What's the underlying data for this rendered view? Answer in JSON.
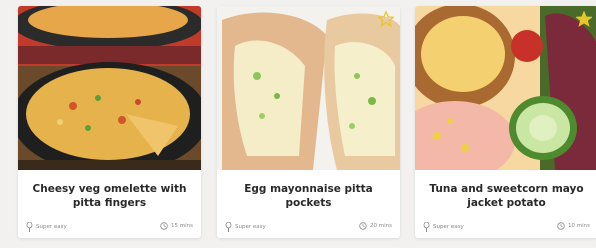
{
  "cards": [
    {
      "title": "Cheesy veg omelette with pitta fingers",
      "difficulty": "Super easy",
      "time": "15 mins",
      "difficulty_icon": "whisk-icon",
      "time_icon": "clock-icon"
    },
    {
      "title": "Egg mayonnaise pitta pockets",
      "difficulty": "Super easy",
      "time": "20 mins",
      "difficulty_icon": "whisk-icon",
      "time_icon": "clock-icon",
      "favourite_icon": "star-icon"
    },
    {
      "title": "Tuna and sweetcorn mayo jacket potato",
      "difficulty": "Super easy",
      "time": "10 mins",
      "difficulty_icon": "whisk-icon",
      "time_icon": "clock-icon",
      "favourite_icon": "star-icon"
    }
  ],
  "colors": {
    "star": "#e8c62a",
    "title_text": "#2a2a2a",
    "meta_text": "#8a8a8a"
  }
}
